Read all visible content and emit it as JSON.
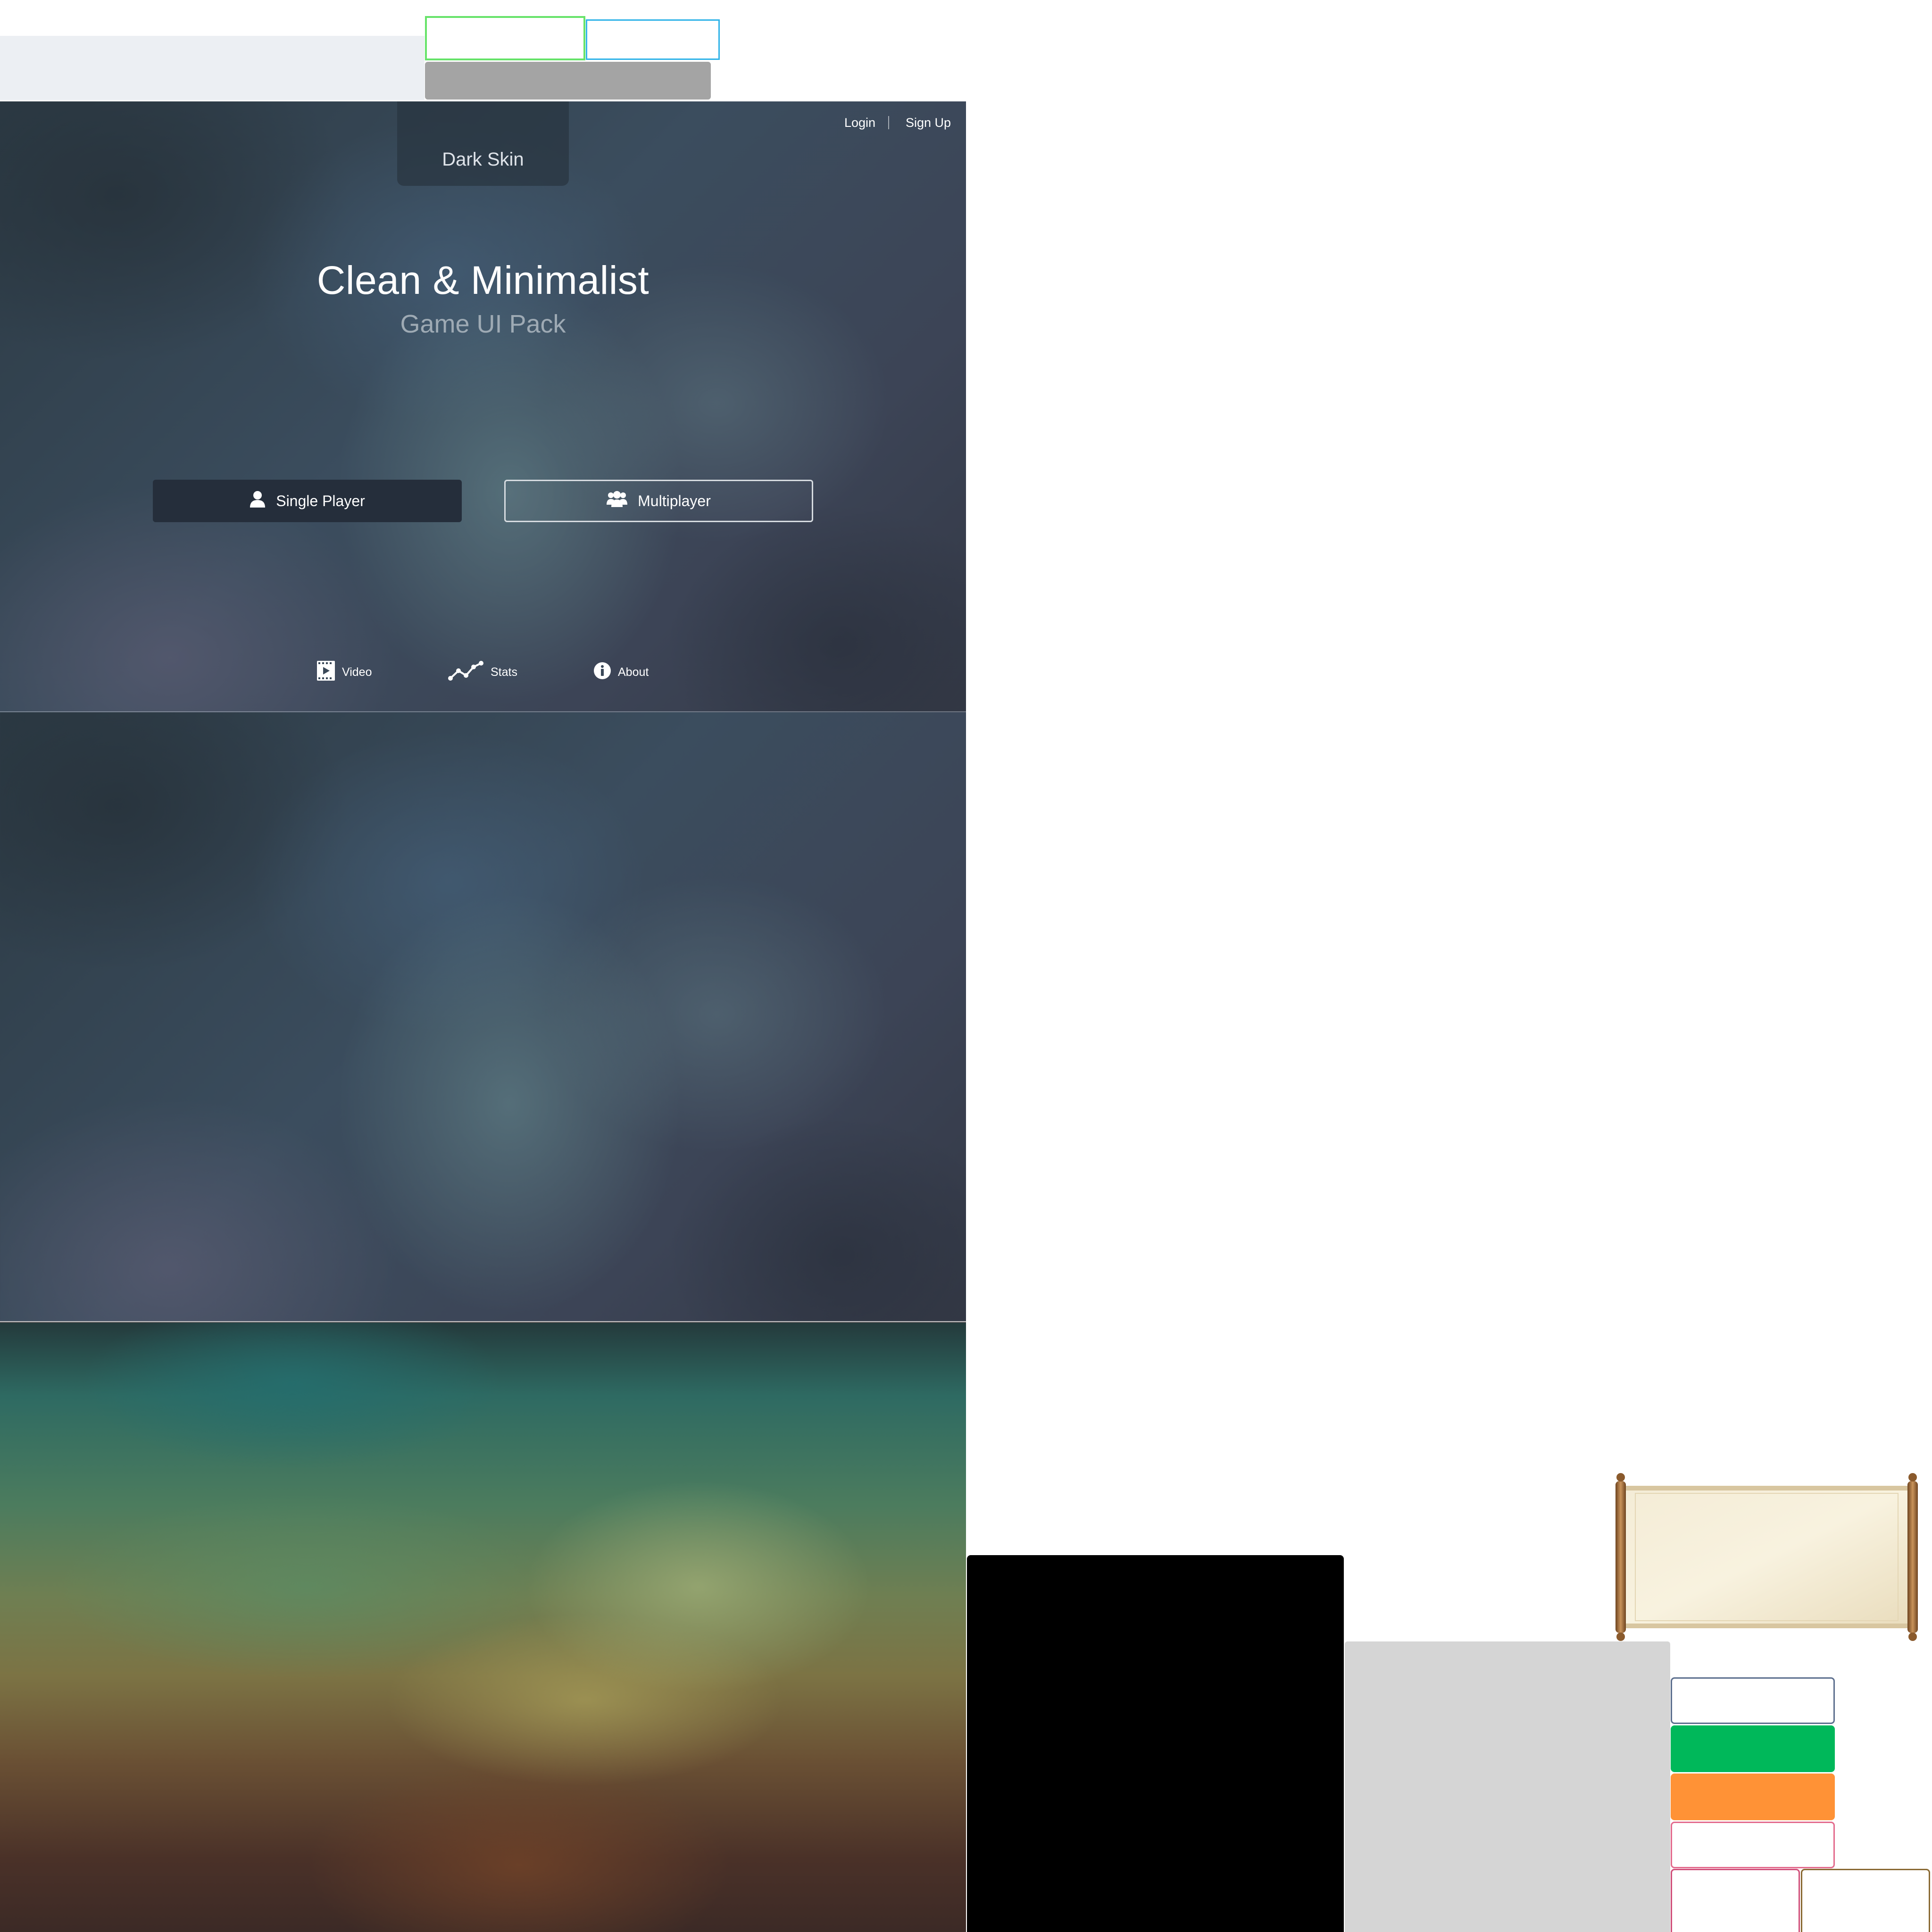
{
  "skin_tab": {
    "label": "Dark Skin"
  },
  "account": {
    "login_label": "Login",
    "signup_label": "Sign Up"
  },
  "hero": {
    "title": "Clean & Minimalist",
    "subtitle": "Game UI Pack"
  },
  "main_menu": {
    "single_player": {
      "label": "Single Player",
      "icon": "user-icon"
    },
    "multiplayer": {
      "label": "Multiplayer",
      "icon": "users-icon"
    }
  },
  "footer_links": [
    {
      "label": "Video",
      "icon": "film-play-icon"
    },
    {
      "label": "Stats",
      "icon": "line-graph-icon"
    },
    {
      "label": "About",
      "icon": "info-icon"
    }
  ],
  "colors": {
    "frame_green": "#67e36a",
    "frame_cyan": "#2fb3e8",
    "button_dark": "#252e3b",
    "slot_green": "#00b85a",
    "slot_orange": "#ff9236",
    "slot_pink_border": "#e36b8d",
    "slot_blue_border": "#5c6f8e"
  }
}
